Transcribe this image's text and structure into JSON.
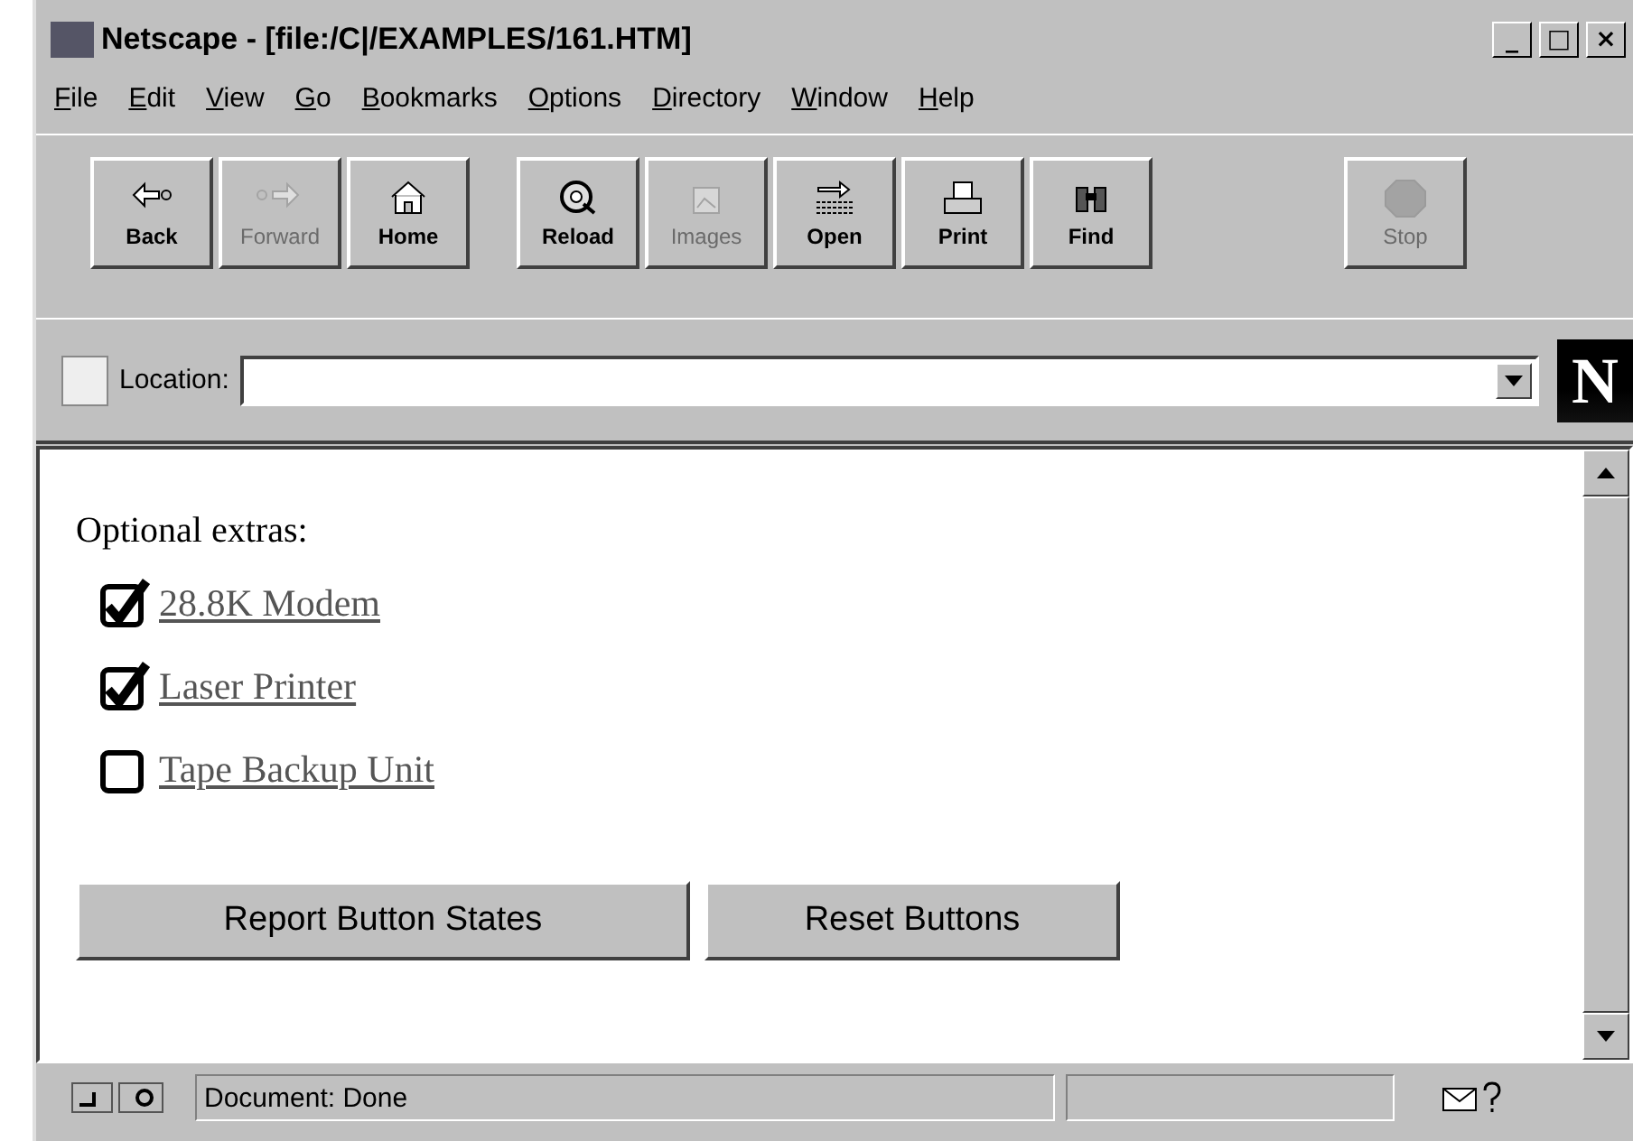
{
  "window": {
    "title": "Netscape - [file:/C|/EXAMPLES/161.HTM]",
    "controls": [
      "_",
      "□",
      "×"
    ]
  },
  "menu": [
    {
      "label": "File"
    },
    {
      "label": "Edit"
    },
    {
      "label": "View"
    },
    {
      "label": "Go"
    },
    {
      "label": "Bookmarks"
    },
    {
      "label": "Options"
    },
    {
      "label": "Directory"
    },
    {
      "label": "Window"
    },
    {
      "label": "Help"
    }
  ],
  "toolbar": [
    [
      {
        "label": "Back",
        "disabled": false
      },
      {
        "label": "Forward",
        "disabled": true
      },
      {
        "label": "Home",
        "disabled": false
      }
    ],
    [
      {
        "label": "Reload",
        "disabled": false
      },
      {
        "label": "Images",
        "disabled": true
      },
      {
        "label": "Open",
        "disabled": false
      },
      {
        "label": "Print",
        "disabled": false
      },
      {
        "label": "Find",
        "disabled": false
      }
    ],
    [
      {
        "label": "Stop",
        "disabled": true
      }
    ]
  ],
  "location": {
    "label": "Location:",
    "logo": "N"
  },
  "page": {
    "heading": "Optional extras:",
    "options": [
      {
        "kind": "checkbox",
        "label": "28.8K Modem",
        "checked": true
      },
      {
        "kind": "checkbox",
        "label": "Laser Printer",
        "checked": true
      },
      {
        "kind": "checkbox",
        "label": "Tape Backup Unit",
        "checked": false
      }
    ],
    "buttons": [
      {
        "label": "Report Button States"
      },
      {
        "label": "Reset Buttons"
      }
    ]
  },
  "status_bar": {
    "text": "Document: Done"
  }
}
